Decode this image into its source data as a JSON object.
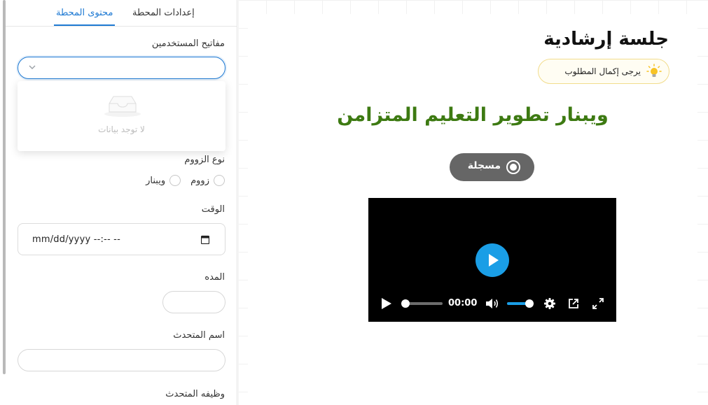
{
  "tabs": {
    "settings": "إعدادات المحطة",
    "content": "محتوى المحطة"
  },
  "form": {
    "users_keys_label": "مفاتيح المستخدمين",
    "dropdown_empty": "لا توجد بيانات",
    "zoom_type_label": "نوع الزووم",
    "zoom_options": [
      "زووم",
      "ويبنار"
    ],
    "time_label": "الوقت",
    "time_value": "mm/dd/yyyy --:-- --",
    "duration_label": "المده",
    "speaker_name_label": "اسم المتحدث",
    "speaker_job_label": "وظيفه المتحدث"
  },
  "preview": {
    "title": "جلسة إرشادية",
    "hint": "يرجى إكمال المطلوب",
    "webinar_title": "ويبنار تطوير التعليم المتزامن",
    "recorded_label": "مسجلة",
    "video": {
      "time": "00:00",
      "progress": 0,
      "volume": 1
    }
  },
  "colors": {
    "accent": "#1f7ad3",
    "webinar_title": "#3d7a12",
    "recorded_bg": "#666666",
    "play_button": "#1a9ee6",
    "hint_border": "#f2dc8c",
    "bulb": "#f7c325"
  }
}
